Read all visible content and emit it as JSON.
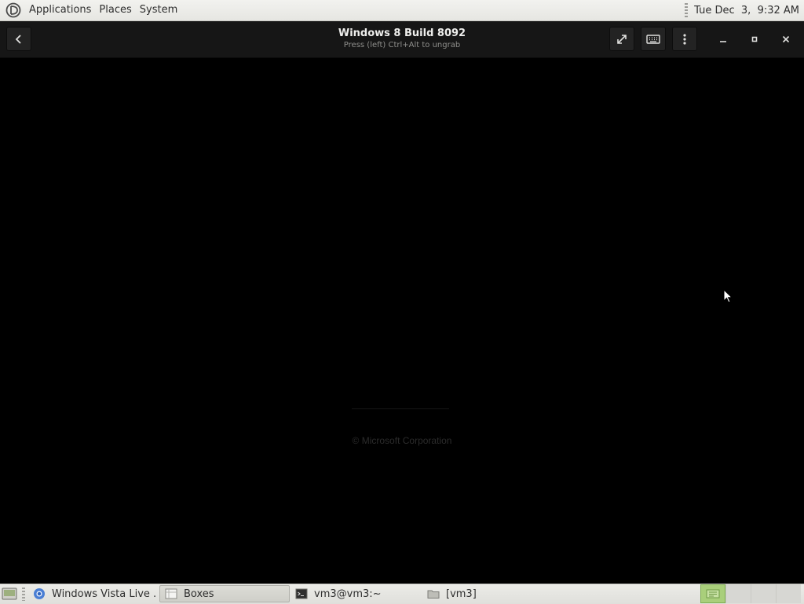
{
  "top_panel": {
    "menus": [
      "Applications",
      "Places",
      "System"
    ],
    "clock": "Tue Dec  3,  9:32 AM"
  },
  "window": {
    "title": "Windows 8 Build 8092",
    "subtitle": "Press (left) Ctrl+Alt to ungrab",
    "buttons": [
      "back-icon",
      "fullscreen-icon",
      "keyboard-icon",
      "menu-icon",
      "minimize-icon",
      "maximize-icon",
      "close-icon"
    ]
  },
  "vm_screen": {
    "copyright": "© Microsoft Corporation"
  },
  "taskbar": {
    "tasks": [
      {
        "label": "Windows Vista Live ...",
        "icon": "chromium-icon",
        "active": false
      },
      {
        "label": "Boxes",
        "icon": "boxes-icon",
        "active": true
      },
      {
        "label": "vm3@vm3:~",
        "icon": "terminal-icon",
        "active": false
      },
      {
        "label": "[vm3]",
        "icon": "folder-icon",
        "active": false
      }
    ],
    "workspaces": 4,
    "active_workspace": 1
  },
  "colors": {
    "panel_bg": "#e6e6e2",
    "header_bg": "#161616",
    "workspace_active": "#a9cf7b"
  }
}
